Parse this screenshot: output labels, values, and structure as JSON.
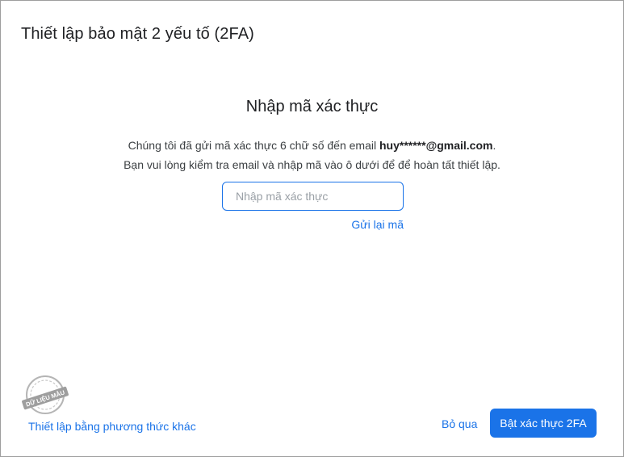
{
  "dialog": {
    "title": "Thiết lập bảo mật 2 yếu tố (2FA)"
  },
  "verify": {
    "heading": "Nhập mã xác thực",
    "line1_prefix": "Chúng tôi đã gửi mã xác thực 6 chữ số đến email ",
    "email_masked": "huy******@gmail.com",
    "line1_suffix": ".",
    "line2": "Bạn vui lòng kiểm tra email và nhập mã vào ô dưới để để hoàn tất thiết lập.",
    "code_input": {
      "value": "",
      "placeholder": "Nhập mã xác thực"
    },
    "resend_label": "Gửi lại mã"
  },
  "footer": {
    "alt_method_label": "Thiết lập bằng phương thức khác",
    "skip_label": "Bỏ qua",
    "enable_label": "Bật xác thực 2FA"
  },
  "watermark": {
    "text": "DỮ LIỆU MẪU"
  },
  "colors": {
    "accent": "#1a73e8",
    "text": "#202124",
    "border": "#9e9e9e"
  }
}
